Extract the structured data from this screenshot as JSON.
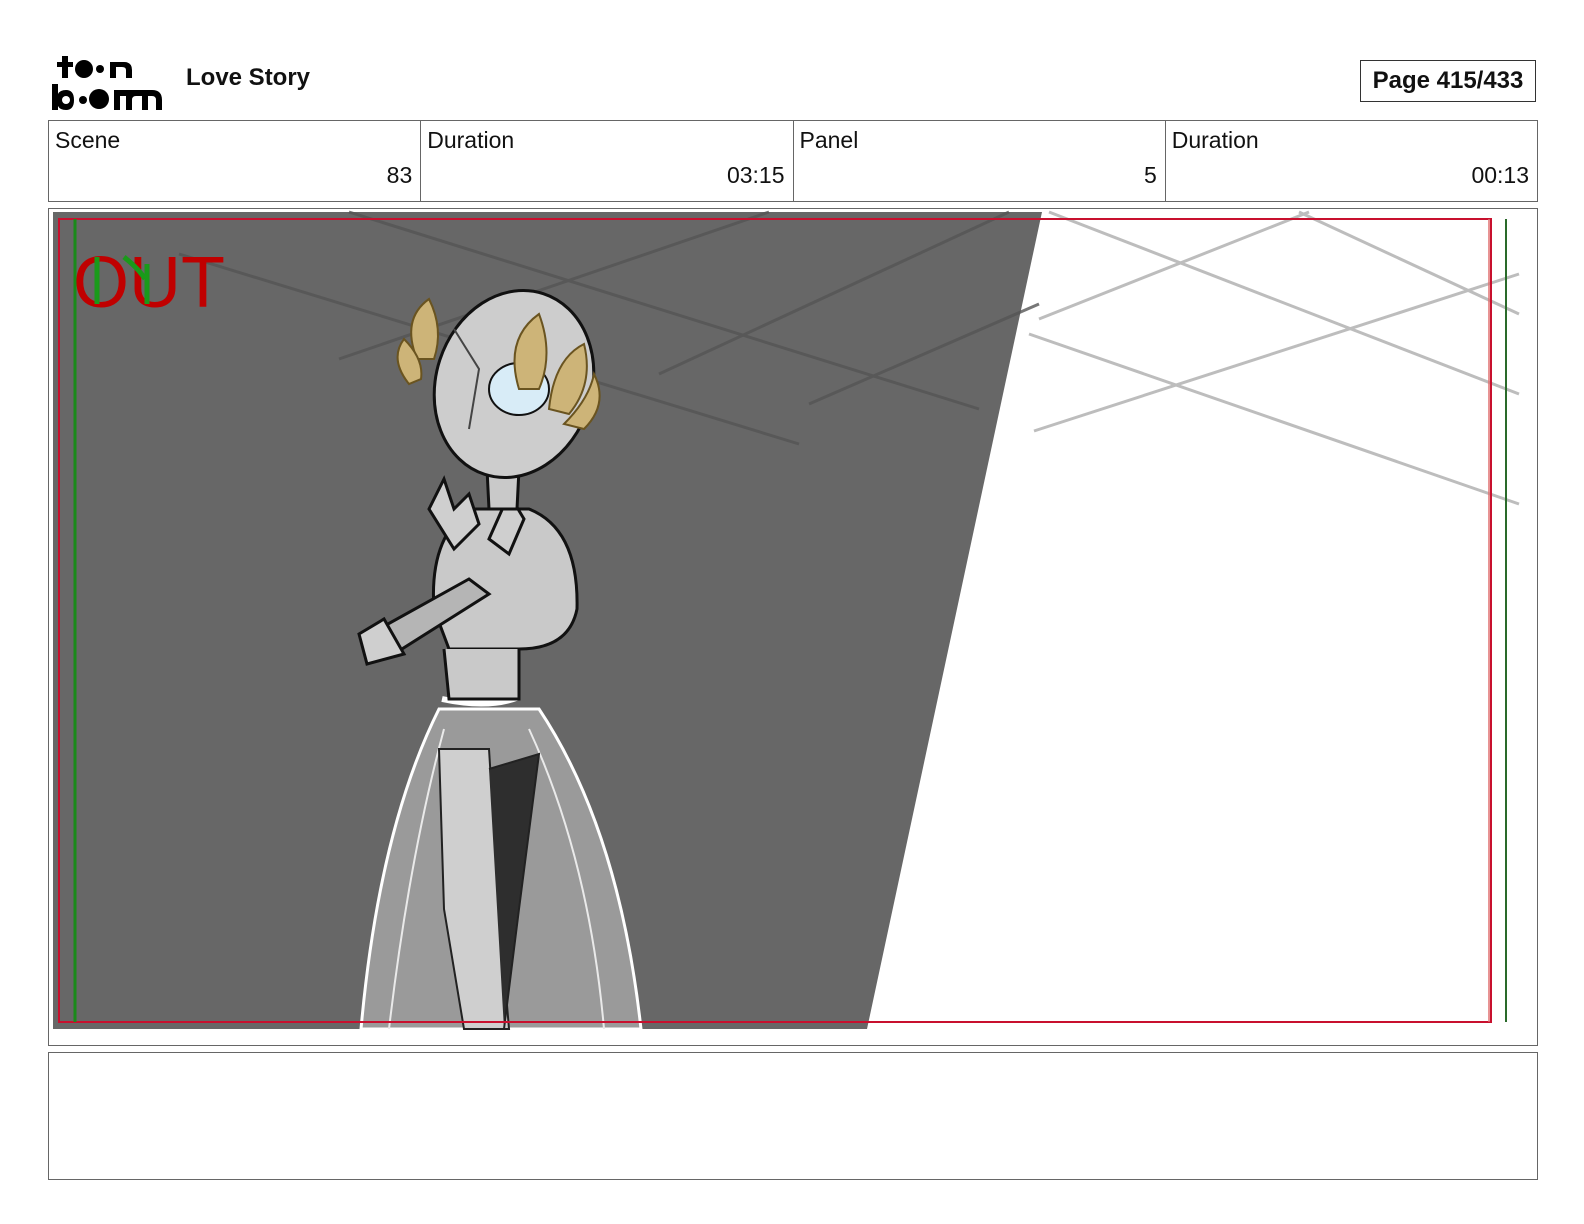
{
  "header": {
    "logo_text": "toon boom",
    "project_title": "Love Story",
    "page_label": "Page 415/433"
  },
  "info": {
    "scene_label": "Scene",
    "scene_value": "83",
    "scene_duration_label": "Duration",
    "scene_duration_value": "03:15",
    "panel_label": "Panel",
    "panel_value": "5",
    "panel_duration_label": "Duration",
    "panel_duration_value": "00:13"
  },
  "panel": {
    "overlay_text": "OUT",
    "overlay_color": "#c00000",
    "safe_frame_color": "#c8102e",
    "title_safe_color": "#1a8a1a",
    "background_dark": "#676767"
  },
  "notes": {
    "text": ""
  }
}
